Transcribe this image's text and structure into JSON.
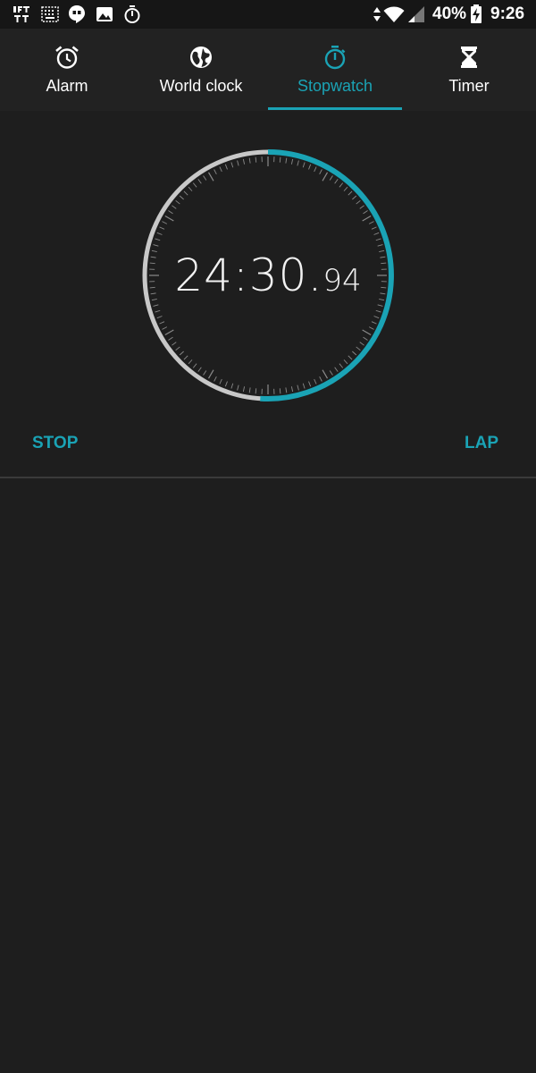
{
  "status_bar": {
    "left_icons": [
      "ifttt-icon",
      "keyboard-grid-icon",
      "hangouts-icon",
      "image-icon",
      "stopwatch-notification-icon"
    ],
    "right_icons": [
      "vibrate-arrows-icon",
      "wifi-icon",
      "signal-icon",
      "battery-charging-icon"
    ],
    "battery_text": "40%",
    "time": "9:26"
  },
  "tabs": [
    {
      "label": "Alarm",
      "icon": "alarm-clock-icon",
      "active": false
    },
    {
      "label": "World clock",
      "icon": "globe-icon",
      "active": false
    },
    {
      "label": "Stopwatch",
      "icon": "stopwatch-icon",
      "active": true
    },
    {
      "label": "Timer",
      "icon": "hourglass-icon",
      "active": false
    }
  ],
  "stopwatch": {
    "time_main": "24:30.",
    "time_fraction": "94",
    "progress_fraction": 0.51
  },
  "buttons": {
    "stop_label": "STOP",
    "lap_label": "LAP"
  },
  "colors": {
    "accent": "#1aa3b5",
    "background": "#1e1e1e",
    "tab_bar": "#222222",
    "ring_track": "#c8c8c8"
  },
  "laps": []
}
